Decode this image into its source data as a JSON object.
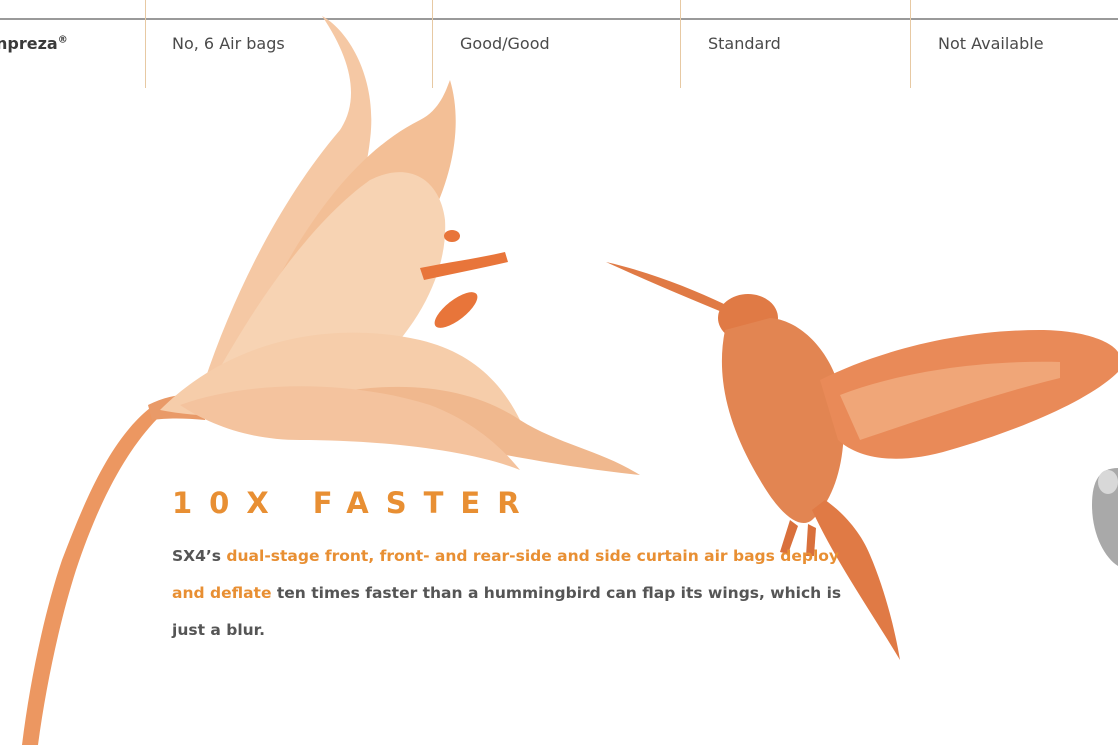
{
  "comparison_row": {
    "model": "npreza",
    "model_mark": "®",
    "airbags": "No, 6 Air bags",
    "rating": "Good/Good",
    "feature": "Standard",
    "availability": "Not Available"
  },
  "feature": {
    "headline": "10X FASTER",
    "body": {
      "lead": "SX4’s ",
      "highlight": "dual-stage front, front- and rear-side and side curtain air bags deploy and deflate",
      "tail": " ten times faster than a hummingbird can flap its wings, which is just a blur."
    }
  },
  "colors": {
    "accent": "#e88f33",
    "body_text": "#555555",
    "lily": "#f2b98c",
    "hummingbird": "#e07a45",
    "rule": "#9a9a9a",
    "separator": "#e7c9a3"
  }
}
